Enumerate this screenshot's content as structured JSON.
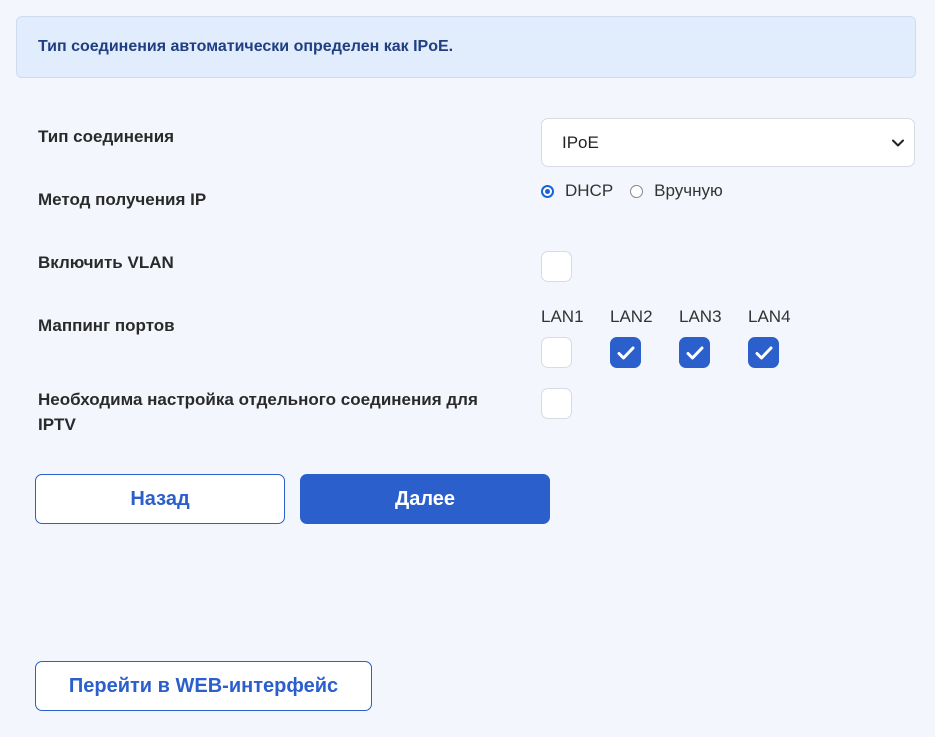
{
  "banner": {
    "text": "Тип соединения автоматически определен как IPoE."
  },
  "form": {
    "connection_type": {
      "label": "Тип соединения",
      "selected": "IPoE"
    },
    "ip_method": {
      "label": "Метод получения IP",
      "options": [
        {
          "label": "DHCP",
          "checked": true
        },
        {
          "label": "Вручную",
          "checked": false
        }
      ]
    },
    "vlan": {
      "label": "Включить VLAN",
      "checked": false
    },
    "port_mapping": {
      "label": "Маппинг портов",
      "ports": [
        {
          "label": "LAN1",
          "checked": false
        },
        {
          "label": "LAN2",
          "checked": true
        },
        {
          "label": "LAN3",
          "checked": true
        },
        {
          "label": "LAN4",
          "checked": true
        }
      ]
    },
    "iptv": {
      "label_line1": "Необходима настройка отдельного соединения для",
      "label_line2": "IPTV",
      "checked": false
    }
  },
  "buttons": {
    "back": "Назад",
    "next": "Далее",
    "web": "Перейти в WEB-интерфейс"
  },
  "colors": {
    "accent": "#2a5fcc",
    "banner_bg": "#e1ecfc",
    "page_bg": "#f3f6fd"
  }
}
